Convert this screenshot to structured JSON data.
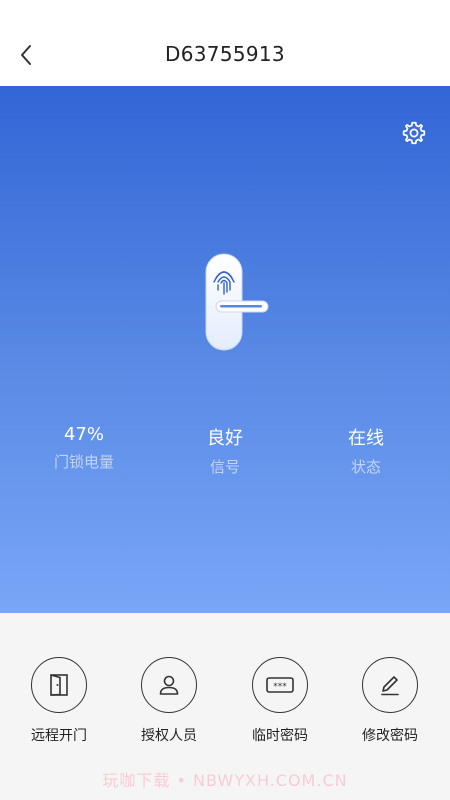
{
  "header": {
    "title": "D63755913",
    "back_icon": "chevron-left-icon"
  },
  "hero": {
    "settings_icon": "gear-icon",
    "illustration": "fingerprint-door-lock",
    "stats": [
      {
        "value": "47%",
        "label": "门锁电量"
      },
      {
        "value": "良好",
        "label": "信号"
      },
      {
        "value": "在线",
        "label": "状态"
      }
    ],
    "gradient_colors": [
      "#3366d6",
      "#7aa6f7"
    ]
  },
  "actions": [
    {
      "label": "远程开门",
      "icon": "door-icon"
    },
    {
      "label": "授权人员",
      "icon": "user-icon"
    },
    {
      "label": "临时密码",
      "icon": "password-icon"
    },
    {
      "label": "修改密码",
      "icon": "pencil-icon"
    }
  ],
  "watermark": "玩咖下载 • NBWYXH.COM.CN"
}
